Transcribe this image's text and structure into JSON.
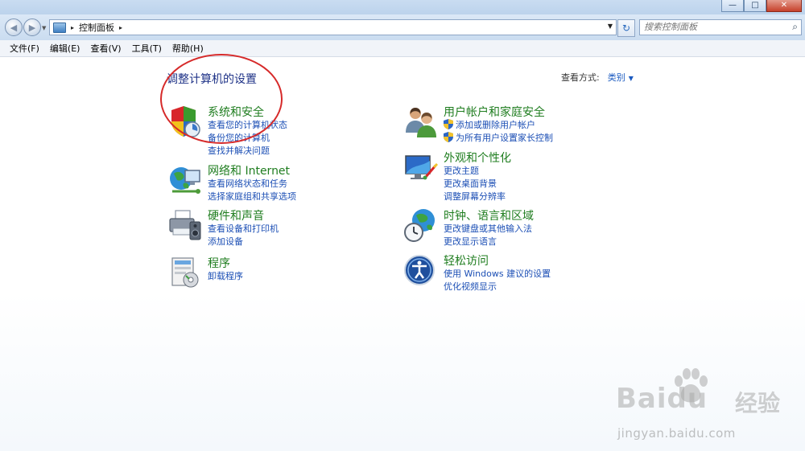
{
  "window": {
    "caption_buttons": [
      "—",
      "□",
      "✕"
    ]
  },
  "nav": {
    "back_glyph": "◀",
    "forward_glyph": "▶",
    "breadcrumb": "控制面板",
    "crumb_separator": "▸",
    "search_placeholder": "搜索控制面板",
    "refresh_glyph": "↻",
    "search_glyph": "⌕"
  },
  "menu": [
    "文件(F)",
    "编辑(E)",
    "查看(V)",
    "工具(T)",
    "帮助(H)"
  ],
  "content": {
    "heading": "调整计算机的设置",
    "view_by_label": "查看方式:",
    "view_by_value": "类别",
    "view_by_arrow": "▼"
  },
  "categories": [
    {
      "title": "系统和安全",
      "icon": "shield-icon",
      "links": [
        "查看您的计算机状态",
        "备份您的计算机",
        "查找并解决问题"
      ]
    },
    {
      "title": "网络和 Internet",
      "icon": "network-icon",
      "links": [
        "查看网络状态和任务",
        "选择家庭组和共享选项"
      ]
    },
    {
      "title": "硬件和声音",
      "icon": "printer-icon",
      "links": [
        "查看设备和打印机",
        "添加设备"
      ]
    },
    {
      "title": "程序",
      "icon": "programs-icon",
      "links": [
        "卸载程序"
      ]
    },
    {
      "title": "用户帐户和家庭安全",
      "icon": "users-icon",
      "links": [
        "添加或删除用户帐户",
        "为所有用户设置家长控制"
      ]
    },
    {
      "title": "外观和个性化",
      "icon": "appearance-icon",
      "links": [
        "更改主题",
        "更改桌面背景",
        "调整屏幕分辨率"
      ]
    },
    {
      "title": "时钟、语言和区域",
      "icon": "clock-globe-icon",
      "links": [
        "更改键盘或其他输入法",
        "更改显示语言"
      ]
    },
    {
      "title": "轻松访问",
      "icon": "ease-of-access-icon",
      "links": [
        "使用 Windows 建议的设置",
        "优化视频显示"
      ]
    }
  ],
  "watermark": {
    "brand": "Baidu",
    "brand_cn": "经验",
    "url": "jingyan.baidu.com"
  },
  "colors": {
    "category_title": "#1f7d1f",
    "link": "#1c4fb5",
    "heading": "#1e3287",
    "annotation_circle": "#d62a2a"
  }
}
